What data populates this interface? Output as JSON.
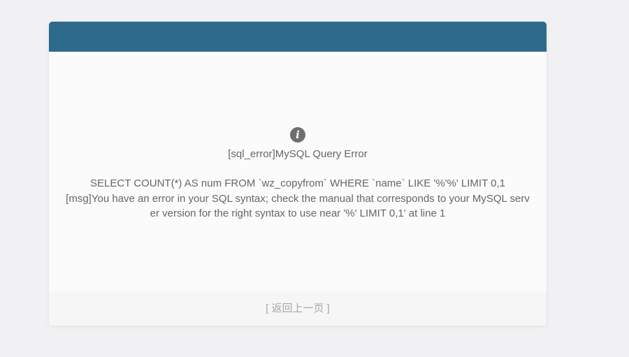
{
  "dialog": {
    "icon": "info-icon",
    "icon_glyph": "i",
    "title": "[sql_error]MySQL Query Error",
    "query": "SELECT COUNT(*) AS num FROM `wz_copyfrom` WHERE `name` LIKE '%'%' LIMIT 0,1",
    "message": "[msg]You have an error in your SQL syntax; check the manual that corresponds to your MySQL server version for the right syntax to use near '%' LIMIT 0,1' at line 1"
  },
  "footer": {
    "back_label": "[ 返回上一页 ]"
  },
  "colors": {
    "header": "#2d6a8c",
    "background": "#f1f1f3",
    "card": "#fbfbfb",
    "text": "#666666",
    "link": "#a7a7a7"
  }
}
